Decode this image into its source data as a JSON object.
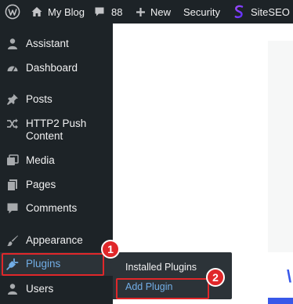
{
  "admin_bar": {
    "site_name": "My Blog",
    "comments_count": "88",
    "new_label": "New",
    "security_label": "Security",
    "siteseo_label": "SiteSEO"
  },
  "sidebar": {
    "items": [
      {
        "label": "Assistant",
        "icon": "person-icon"
      },
      {
        "label": "Dashboard",
        "icon": "dashboard-gauge-icon"
      },
      {
        "label": "Posts",
        "icon": "pushpin-icon"
      },
      {
        "label": "HTTP2 Push Content",
        "line1": "HTTP2 Push",
        "line2": "Content",
        "icon": "shuffle-icon"
      },
      {
        "label": "Media",
        "icon": "media-icon"
      },
      {
        "label": "Pages",
        "icon": "pages-icon"
      },
      {
        "label": "Comments",
        "icon": "speech-bubble-icon"
      },
      {
        "label": "Appearance",
        "icon": "paintbrush-icon"
      },
      {
        "label": "Plugins",
        "icon": "plug-icon"
      },
      {
        "label": "Users",
        "icon": "user-icon"
      }
    ]
  },
  "plugins_submenu": {
    "items": [
      "Installed Plugins",
      "Add Plugin"
    ]
  },
  "annotations": {
    "step1": "1",
    "step2": "2"
  },
  "colors": {
    "admin_dark": "#1d2327",
    "submenu_bg": "#2c3338",
    "highlight_blue": "#72aee6",
    "annotation_red": "#e0272a",
    "text_light": "#f0f0f1"
  }
}
